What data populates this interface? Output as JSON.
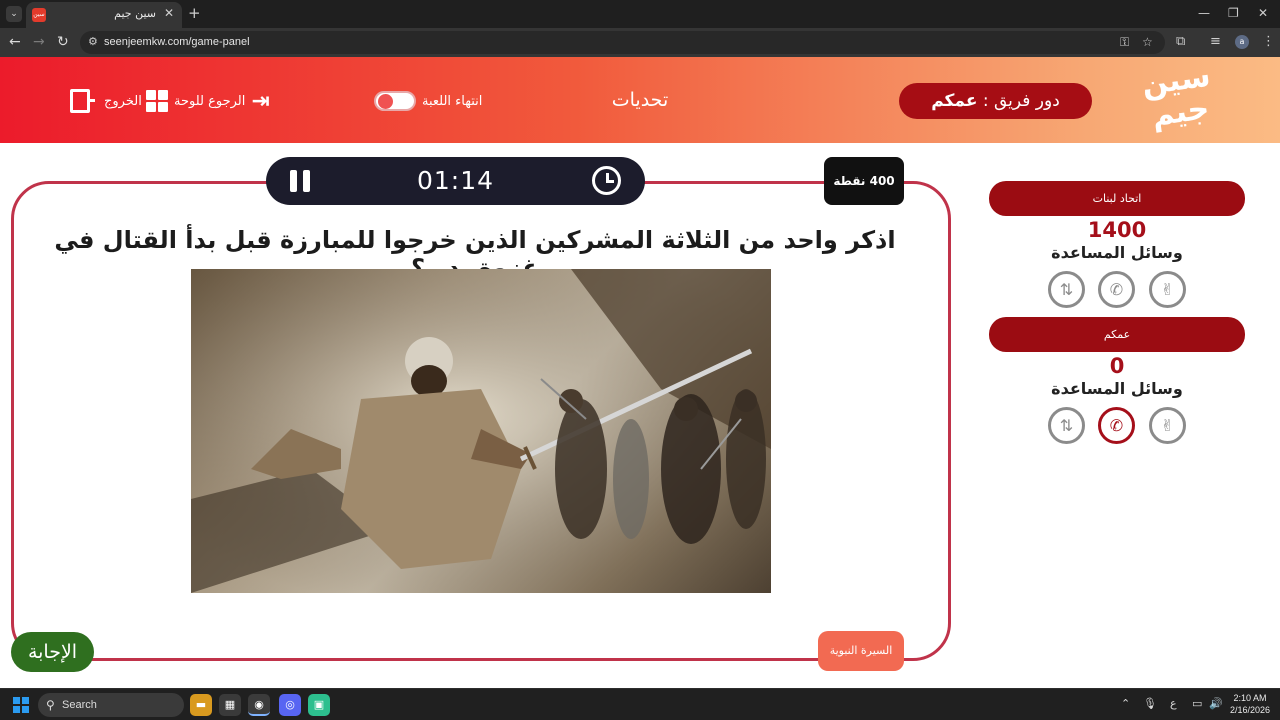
{
  "browser": {
    "tab_title": "سين جيم",
    "favicon_text": "سين",
    "url": "seenjeemkw.com/game-panel",
    "profile_letter": "a"
  },
  "header": {
    "logo_text": "سين جيم",
    "turn_label": "دور فريق :",
    "turn_team": "عمكم",
    "mode_title": "تحديات",
    "end_game_label": "انتهاء اللعبة",
    "back_to_board_label": "الرجوع للوحة",
    "exit_label": "الخروج"
  },
  "question_panel": {
    "timer": "01:14",
    "points": "400 نقطة",
    "question": "اذكر واحد من الثلاثة المشركين الذين خرجوا للمبارزة قبل بدأ القتال في غزوة بدر ؟",
    "category": "السيرة النبوية",
    "answer_label": "الإجابة"
  },
  "teams": [
    {
      "name": "اتحاد لبنات",
      "score": "1400",
      "helps_label": "وسائل المساعدة"
    },
    {
      "name": "عمكم",
      "score": "0",
      "helps_label": "وسائل المساعدة"
    }
  ],
  "colors": {
    "header_start": "#ec1b2b",
    "header_end": "#fbbb84",
    "team_pill": "#9b0c12",
    "card_border": "#c0334a",
    "answer_button": "#2f6f1f",
    "category_button": "#f26a52"
  },
  "taskbar": {
    "search_label": "Search",
    "time": "2:10 AM",
    "date": "2/16/2026",
    "lang": "ع"
  }
}
